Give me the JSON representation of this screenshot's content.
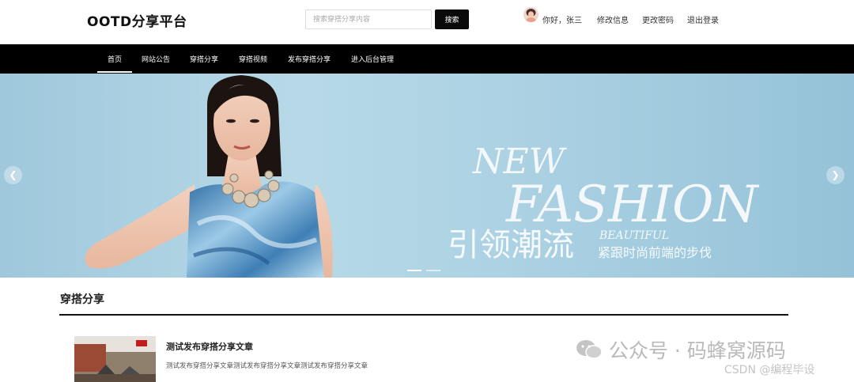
{
  "header": {
    "logo": "OOTD分享平台",
    "search": {
      "placeholder": "搜索穿搭分享内容",
      "button_label": "搜索"
    },
    "greeting": "你好，张三",
    "links": [
      "修改信息",
      "更改密码",
      "退出登录"
    ]
  },
  "nav": {
    "items": [
      "首页",
      "网站公告",
      "穿搭分享",
      "穿搭视频",
      "发布穿搭分享",
      "进入后台管理"
    ],
    "active_index": 0
  },
  "banner": {
    "headline_en_1": "NEW",
    "headline_en_2": "FASHION",
    "headline_cn": "引领潮流",
    "sub_en": "BEAUTIFUL",
    "sub_cn": "紧跟时尚前端的步伐",
    "prev_icon": "chevron-left-icon",
    "next_icon": "chevron-right-icon",
    "slide_count": 2,
    "active_slide": 0
  },
  "section": {
    "title": "穿搭分享"
  },
  "posts": [
    {
      "title": "测试发布穿搭分享文章",
      "excerpt": "测试发布穿搭分享文章测试发布穿搭分享文章测试发布穿搭分享文章"
    }
  ],
  "watermark": {
    "main": "公众号 · 码蜂窝源码",
    "sub": "CSDN @编程毕设"
  },
  "colors": {
    "nav_bg": "#000000",
    "accent": "#0a0a0a",
    "banner_bg": "#a9d0e2"
  }
}
